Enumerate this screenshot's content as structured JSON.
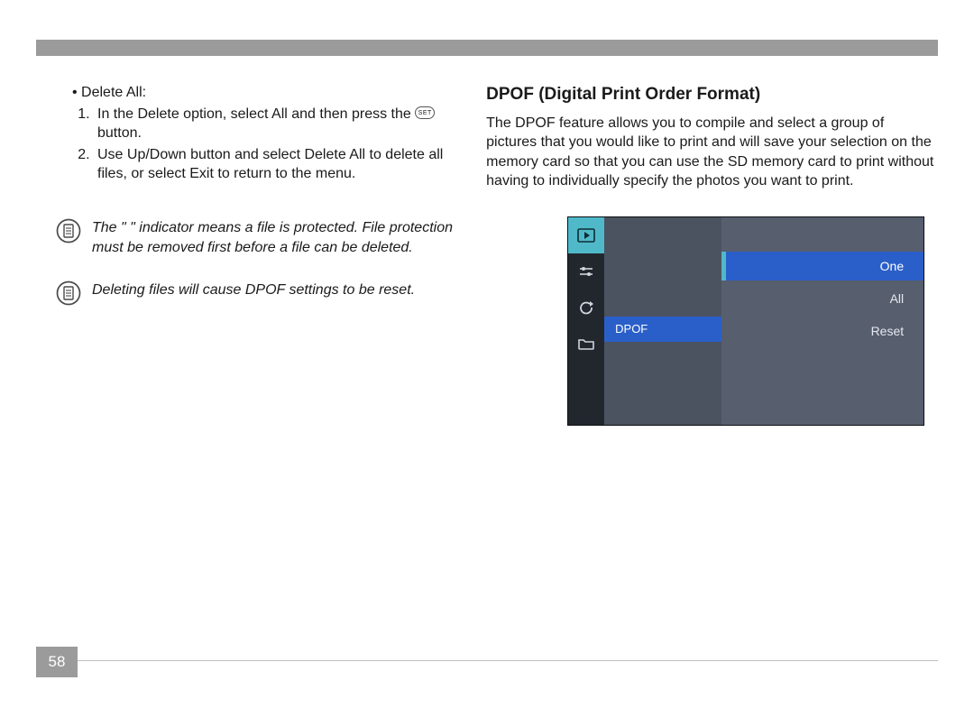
{
  "pageNumber": "58",
  "left": {
    "bulletLabel": "Delete All:",
    "step1_before": "In the Delete option, select All and then press the ",
    "setBadge": "SET",
    "step1_after": " button.",
    "step2": "Use Up/Down button and select Delete All to delete all files, or select Exit to return to the menu.",
    "note1": "The \"        \" indicator means a file is protected. File protection must be removed first before a file can be deleted.",
    "note2": "Deleting files will cause DPOF settings to be reset."
  },
  "right": {
    "heading": "DPOF (Digital Print Order Format)",
    "paragraph": "The DPOF feature allows you to compile and select a group of pictures that you would like to print and will save your selection on the memory card so that you can use the SD memory card to print without having to individually specify the photos you want to print."
  },
  "cameraUI": {
    "selectedLabel": "DPOF",
    "options": [
      "One",
      "All",
      "Reset"
    ]
  }
}
